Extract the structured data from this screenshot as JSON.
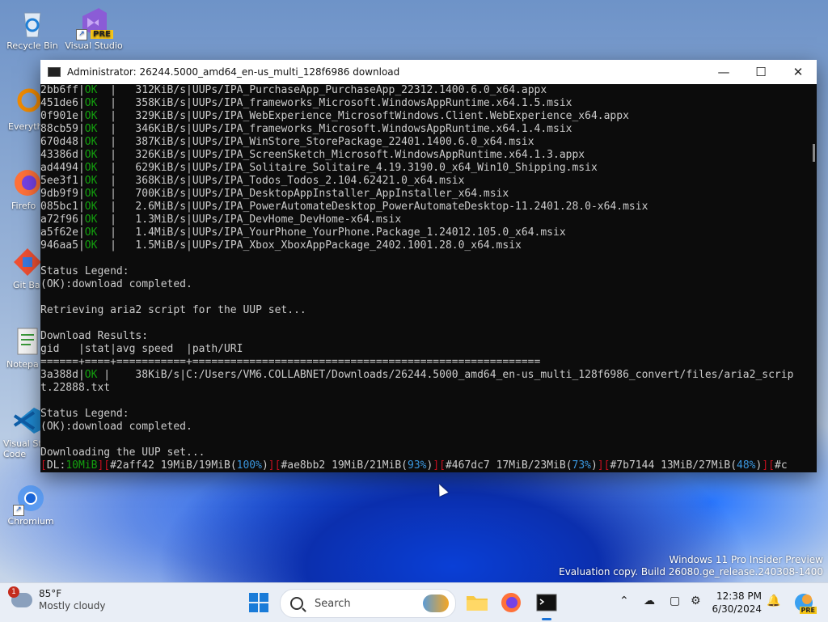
{
  "desktop": {
    "icons": [
      {
        "label": "Recycle Bin"
      },
      {
        "label": "Visual Studio",
        "badge": "PRE"
      },
      {
        "label": "Everyth"
      },
      {
        "label": "Firefo"
      },
      {
        "label": "Git Ba"
      },
      {
        "label": "Notepa"
      },
      {
        "label": "Visual St Code"
      },
      {
        "label": "Chromium"
      }
    ]
  },
  "window": {
    "title": "Administrator:  26244.5000_amd64_en-us_multi_128f6986 download",
    "minimize": "—",
    "maximize": "☐",
    "close": "✕"
  },
  "terminal": {
    "downloads": [
      {
        "gid": "2bb6ff",
        "stat": "OK",
        "speed": "312KiB/s",
        "path": "UUPs/IPA_PurchaseApp_PurchaseApp_22312.1400.6.0_x64.appx"
      },
      {
        "gid": "451de6",
        "stat": "OK",
        "speed": "358KiB/s",
        "path": "UUPs/IPA_frameworks_Microsoft.WindowsAppRuntime.x64.1.5.msix"
      },
      {
        "gid": "0f901e",
        "stat": "OK",
        "speed": "329KiB/s",
        "path": "UUPs/IPA_WebExperience_MicrosoftWindows.Client.WebExperience_x64.appx"
      },
      {
        "gid": "88cb59",
        "stat": "OK",
        "speed": "346KiB/s",
        "path": "UUPs/IPA_frameworks_Microsoft.WindowsAppRuntime.x64.1.4.msix"
      },
      {
        "gid": "670d48",
        "stat": "OK",
        "speed": "387KiB/s",
        "path": "UUPs/IPA_WinStore_StorePackage_22401.1400.6.0_x64.msix"
      },
      {
        "gid": "43386d",
        "stat": "OK",
        "speed": "326KiB/s",
        "path": "UUPs/IPA_ScreenSketch_Microsoft.WindowsAppRuntime.x64.1.3.appx"
      },
      {
        "gid": "ad4494",
        "stat": "OK",
        "speed": "629KiB/s",
        "path": "UUPs/IPA_Solitaire_Solitaire_4.19.3190.0_x64_Win10_Shipping.msix"
      },
      {
        "gid": "5ee3f1",
        "stat": "OK",
        "speed": "368KiB/s",
        "path": "UUPs/IPA_Todos_Todos_2.104.62421.0_x64.msix"
      },
      {
        "gid": "9db9f9",
        "stat": "OK",
        "speed": "700KiB/s",
        "path": "UUPs/IPA_DesktopAppInstaller_AppInstaller_x64.msix"
      },
      {
        "gid": "085bc1",
        "stat": "OK",
        "speed": "2.6MiB/s",
        "path": "UUPs/IPA_PowerAutomateDesktop_PowerAutomateDesktop-11.2401.28.0-x64.msix"
      },
      {
        "gid": "a72f96",
        "stat": "OK",
        "speed": "1.3MiB/s",
        "path": "UUPs/IPA_DevHome_DevHome-x64.msix"
      },
      {
        "gid": "a5f62e",
        "stat": "OK",
        "speed": "1.4MiB/s",
        "path": "UUPs/IPA_YourPhone_YourPhone.Package_1.24012.105.0_x64.msix"
      },
      {
        "gid": "946aa5",
        "stat": "OK",
        "speed": "1.5MiB/s",
        "path": "UUPs/IPA_Xbox_XboxAppPackage_2402.1001.28.0_x64.msix"
      }
    ],
    "legend_title_1": "Status Legend:",
    "legend_ok_1": "(OK):download completed.",
    "retrieving": "Retrieving aria2 script for the UUP set...",
    "results_title": "Download Results:",
    "results_header": "gid   |stat|avg speed  |path/URI",
    "results_rule": "======+====+===========+=======================================================",
    "result_row": {
      "gid": "3a388d",
      "stat": "OK",
      "speed": "38KiB/s",
      "path_line1": "C:/Users/VM6.COLLABNET/Downloads/26244.5000_amd64_en-us_multi_128f6986_convert/files/aria2_scrip",
      "path_line2": "t.22888.txt"
    },
    "legend_title_2": "Status Legend:",
    "legend_ok_2": "(OK):download completed.",
    "downloading": "Downloading the UUP set...",
    "status": {
      "dl_label": "DL:",
      "dl_value": "10MiB",
      "items": [
        {
          "gid": "#2aff42",
          "progress": "19MiB/19MiB",
          "pct": "100%"
        },
        {
          "gid": "#ae8bb2",
          "progress": "19MiB/21MiB",
          "pct": "93%"
        },
        {
          "gid": "#467dc7",
          "progress": "17MiB/23MiB",
          "pct": "73%"
        },
        {
          "gid": "#7b7144",
          "progress": "13MiB/27MiB",
          "pct": "48%"
        }
      ],
      "tail": "#c"
    }
  },
  "watermark": {
    "line1": "Windows 11 Pro Insider Preview",
    "line2": "Evaluation copy. Build 26080.ge_release.240308-1400"
  },
  "taskbar": {
    "weather_badge": "1",
    "temperature": "85°F",
    "condition": "Mostly cloudy",
    "search_label": "Search",
    "time": "12:38 PM",
    "date": "6/30/2024",
    "copilot_badge": "PRE"
  }
}
